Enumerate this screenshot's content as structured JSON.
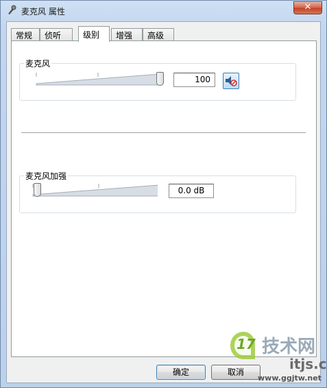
{
  "window": {
    "title": "麦克风 属性",
    "close_label": "✕"
  },
  "tabs": [
    {
      "label": "常规",
      "active": false
    },
    {
      "label": "侦听",
      "active": false
    },
    {
      "label": "级别",
      "active": true
    },
    {
      "label": "增强",
      "active": false
    },
    {
      "label": "高级",
      "active": false
    }
  ],
  "microphone": {
    "label": "麦克风",
    "value": "100",
    "level": 1.0
  },
  "boost": {
    "label": "麦克风加强",
    "value": "0.0 dB",
    "level": 0.0
  },
  "buttons": {
    "ok": "确定",
    "cancel": "取消"
  },
  "watermark": {
    "logo": "17",
    "brand": "技术网",
    "sub": "itjs.cn",
    "url": "www.ggjtw.net"
  },
  "colors": {
    "accent": "#3c7fb1",
    "mute_red": "#d6302b"
  },
  "icons": {
    "title": "microphone-icon",
    "mute": "speaker-muted-icon"
  }
}
